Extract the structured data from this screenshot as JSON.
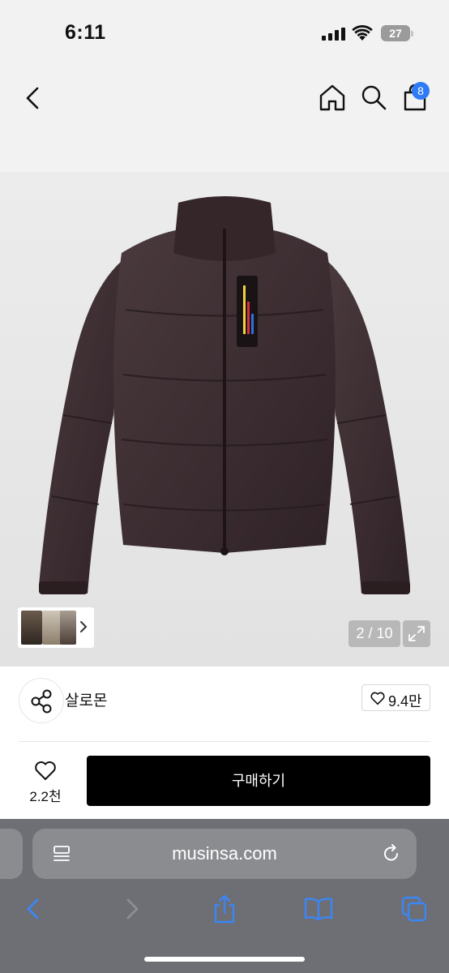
{
  "status_bar": {
    "time": "6:11",
    "battery": "27"
  },
  "header": {
    "cart_count": "8"
  },
  "gallery": {
    "counter": "2 / 10"
  },
  "brand": {
    "name": "살로몬",
    "like_count": "9.4만"
  },
  "product": {
    "like_count": "2.2천",
    "buy_label": "구매하기"
  },
  "browser": {
    "url": "musinsa.com"
  },
  "colors": {
    "accent": "#2f7bf5",
    "buy_button": "#000000",
    "browser_bar": "#6d6f74",
    "jacket": "#3b2a2e"
  },
  "icons": [
    "back-icon",
    "home-icon",
    "search-icon",
    "cart-icon",
    "expand-icon",
    "share-icon",
    "heart-icon",
    "reader-icon",
    "reload-icon",
    "share-icon",
    "bookmarks-icon",
    "tabs-icon"
  ]
}
